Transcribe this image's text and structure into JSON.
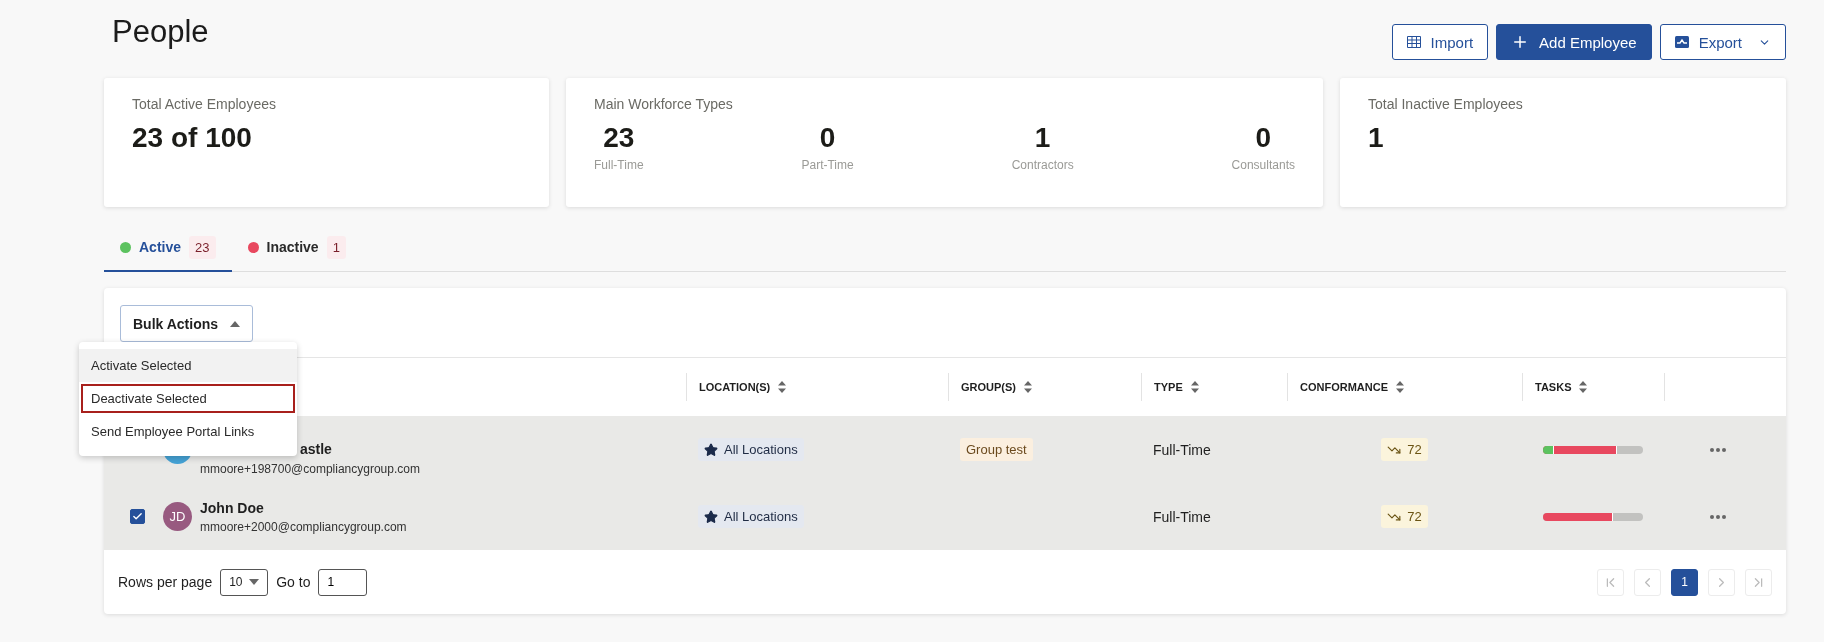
{
  "page": {
    "title": "People"
  },
  "actions": [
    {
      "kind": "import",
      "label": "Import"
    },
    {
      "kind": "add",
      "label": "Add Employee"
    },
    {
      "kind": "export",
      "label": "Export"
    }
  ],
  "stats": [
    {
      "kind": "single",
      "title": "Total Active Employees",
      "value": "23 of 100"
    },
    {
      "kind": "breakdown",
      "title": "Main Workforce Types",
      "items": [
        {
          "value": "23",
          "label": "Full-Time"
        },
        {
          "value": "0",
          "label": "Part-Time"
        },
        {
          "value": "1",
          "label": "Contractors"
        },
        {
          "value": "0",
          "label": "Consultants"
        }
      ]
    },
    {
      "kind": "single",
      "title": "Total Inactive Employees",
      "value": "1"
    }
  ],
  "tabs": [
    {
      "label": "Active",
      "count": "23",
      "color": "#5cc25f",
      "selected": true
    },
    {
      "label": "Inactive",
      "count": "1",
      "color": "#e8485f",
      "selected": false
    }
  ],
  "bulk_actions": {
    "label": "Bulk Actions",
    "expanded": true,
    "menu": [
      {
        "label": "Activate Selected",
        "hovered": true,
        "focused": false
      },
      {
        "label": "Deactivate Selected",
        "hovered": false,
        "focused": true
      },
      {
        "label": "Send Employee Portal Links",
        "hovered": false,
        "focused": false
      }
    ]
  },
  "table": {
    "columns": [
      "LOCATION(S)",
      "GROUP(S)",
      "TYPE",
      "CONFORMANCE",
      "TASKS"
    ],
    "rows": [
      {
        "partly_covered": true,
        "avatar": {
          "color": "#45a3d6"
        },
        "name": "astle",
        "email": "mmoore+198700@compliancygroup.com",
        "location": "All Locations",
        "group": "Group test",
        "type": "Full-Time",
        "conformance": "72",
        "tasks": [
          {
            "color": "#5cc25f",
            "level": 0.11
          },
          {
            "color": "#e8485f",
            "level": 0.74
          }
        ]
      },
      {
        "partly_covered": false,
        "checked": true,
        "avatar": {
          "color": "#985a80",
          "initials": "JD"
        },
        "name": "John Doe",
        "email": "mmoore+2000@compliancygroup.com",
        "location": "All Locations",
        "type": "Full-Time",
        "conformance": "72",
        "tasks": [
          {
            "color": "#e8485f",
            "level": 0.7
          }
        ]
      }
    ]
  },
  "footer": {
    "rows_label": "Rows per page",
    "rows_value": "10",
    "goto_label": "Go to",
    "goto_value": "1",
    "nav": [
      {
        "kind": "first",
        "disabled": true
      },
      {
        "kind": "prev",
        "disabled": true
      },
      {
        "kind": "page",
        "label": "1",
        "selected": true
      },
      {
        "kind": "next",
        "disabled": true
      },
      {
        "kind": "last",
        "disabled": true
      }
    ]
  }
}
